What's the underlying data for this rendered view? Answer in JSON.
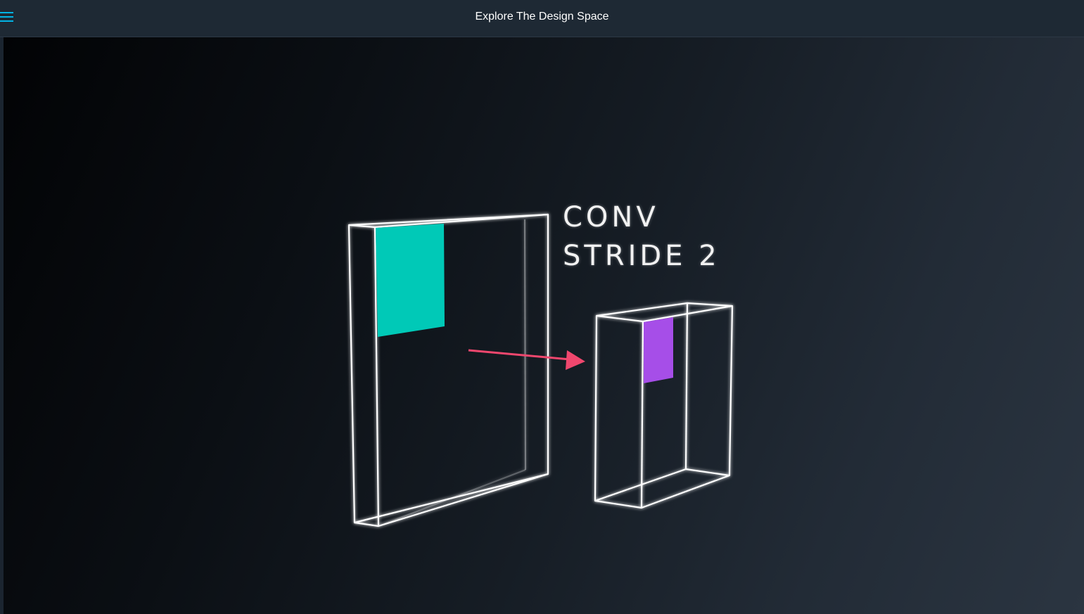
{
  "header": {
    "title": "Explore The Design Space",
    "menu_icon": "hamburger-menu-icon"
  },
  "video": {
    "caption_line1": "CONV",
    "caption_line2": "STRIDE 2"
  },
  "colors": {
    "accent": "#02b3e4",
    "input_patch": "#00c9b7",
    "output_patch": "#a64ee8",
    "arrow": "#f0476e",
    "wireframe": "#ffffff"
  }
}
